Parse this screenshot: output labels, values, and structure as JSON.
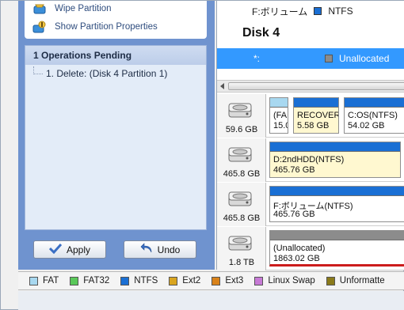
{
  "left": {
    "operations": [
      {
        "label": "Wipe Partition",
        "icon": "wipe-partition-icon"
      },
      {
        "label": "Show Partition Properties",
        "icon": "partition-properties-icon"
      }
    ],
    "pending": {
      "title": "1 Operations Pending",
      "items": [
        "1. Delete: (Disk 4 Partition 1)"
      ]
    },
    "apply_label": "Apply",
    "undo_label": "Undo"
  },
  "right": {
    "volume": {
      "name": "F:ボリューム",
      "fs": "NTFS",
      "color": "#1a6fd4"
    },
    "disk_title": "Disk 4",
    "selected_row": {
      "drive": "*:",
      "fs": "Unallocated",
      "color": "#8c8c8c"
    },
    "disks": [
      {
        "size": "59.6 GB",
        "partitions": [
          {
            "name": "(FA",
            "size": "15.0",
            "bar": "#a8d8f0",
            "used": false
          },
          {
            "name": "RECOVER",
            "size": "5.58 GB",
            "bar": "#1a6fd4",
            "used": true
          },
          {
            "name": "C:OS(NTFS)",
            "size": "54.02 GB",
            "bar": "#1a6fd4",
            "used": false
          }
        ]
      },
      {
        "size": "465.8 GB",
        "partitions": [
          {
            "name": "D:2ndHDD(NTFS)",
            "size": "465.76 GB",
            "bar": "#1a6fd4",
            "used": true
          }
        ]
      },
      {
        "size": "465.8 GB",
        "partitions": [
          {
            "name": "F:ボリューム(NTFS)",
            "size": "465.76 GB",
            "bar": "#1a6fd4",
            "used": false
          }
        ]
      },
      {
        "size": "1.8 TB",
        "partitions": [
          {
            "name": "(Unallocated)",
            "size": "1863.02 GB",
            "bar": "#8c8c8c",
            "used": false
          }
        ]
      }
    ]
  },
  "legend": [
    {
      "label": "FAT",
      "color": "#a8d8f0"
    },
    {
      "label": "FAT32",
      "color": "#5ac85a"
    },
    {
      "label": "NTFS",
      "color": "#1a6fd4"
    },
    {
      "label": "Ext2",
      "color": "#d9a520"
    },
    {
      "label": "Ext3",
      "color": "#d9821a"
    },
    {
      "label": "Linux Swap",
      "color": "#c77ad6"
    },
    {
      "label": "Unformatte",
      "color": "#8a7a1a"
    }
  ]
}
